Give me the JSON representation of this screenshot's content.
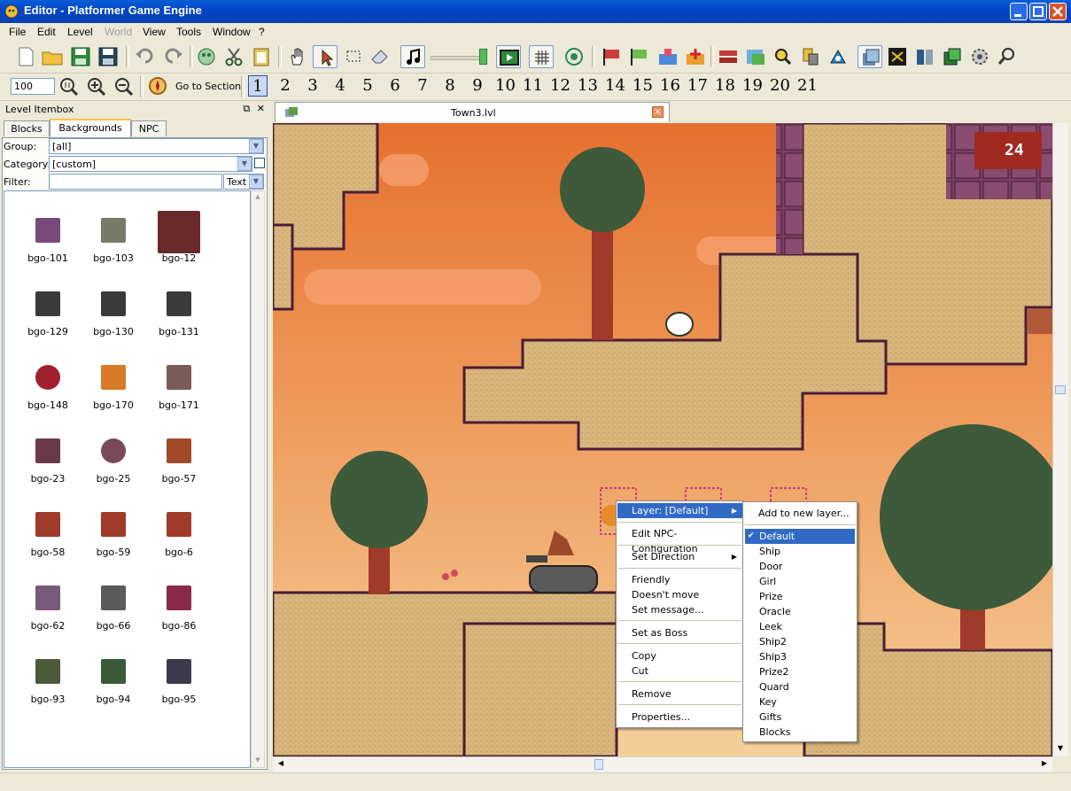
{
  "window": {
    "title": "Editor - Platformer Game Engine"
  },
  "menubar": {
    "items": [
      "File",
      "Edit",
      "Level",
      "World",
      "View",
      "Tools",
      "Window",
      "?"
    ],
    "disabled": [
      "World"
    ]
  },
  "toolbar2": {
    "zoom_value": "100",
    "goto_section_label": "Go to Section",
    "sections": [
      "1",
      "2",
      "3",
      "4",
      "5",
      "6",
      "7",
      "8",
      "9",
      "10",
      "11",
      "12",
      "13",
      "14",
      "15",
      "16",
      "17",
      "18",
      "19",
      "20",
      "21"
    ],
    "active_section": "1"
  },
  "dock": {
    "title": "Level Itembox",
    "tabs": [
      "Blocks",
      "Backgrounds",
      "NPC"
    ],
    "active_tab": "Backgrounds",
    "group_label": "Group:",
    "group_value": "[all]",
    "category_label": "Category:",
    "category_value": "[custom]",
    "filter_label": "Filter:",
    "filter_value": "",
    "filter_mode": "Text",
    "items": [
      "bgo-101",
      "bgo-103",
      "bgo-12",
      "bgo-129",
      "bgo-130",
      "bgo-131",
      "bgo-148",
      "bgo-170",
      "bgo-171",
      "bgo-23",
      "bgo-25",
      "bgo-57",
      "bgo-58",
      "bgo-59",
      "bgo-6",
      "bgo-62",
      "bgo-66",
      "bgo-86",
      "bgo-93",
      "bgo-94",
      "bgo-95"
    ]
  },
  "editor": {
    "document_tab": "Town3.lvl",
    "hud_counter": "24"
  },
  "context_menu": {
    "layer_item": "Layer: [Default]",
    "items": [
      "Edit NPC-Configuration",
      "Set Direction",
      "Friendly",
      "Doesn't move",
      "Set message...",
      "Set as Boss",
      "Copy",
      "Cut",
      "Remove",
      "Properties..."
    ]
  },
  "layer_submenu": {
    "add_new": "Add to new layer...",
    "checked": "Default",
    "layers": [
      "Default",
      "Ship",
      "Door",
      "Girl",
      "Prize",
      "Oracle",
      "Leek",
      "Ship2",
      "Ship3",
      "Prize2",
      "Quard",
      "Key",
      "Gifts",
      "Blocks"
    ]
  },
  "colors": {
    "sky_top": "#e8773a",
    "sky_bottom": "#f2c890",
    "ground": "#d8b77a",
    "ground_edge": "#5a2a3c",
    "highlight": "#316ac5",
    "brick": "#6e3a5a"
  }
}
